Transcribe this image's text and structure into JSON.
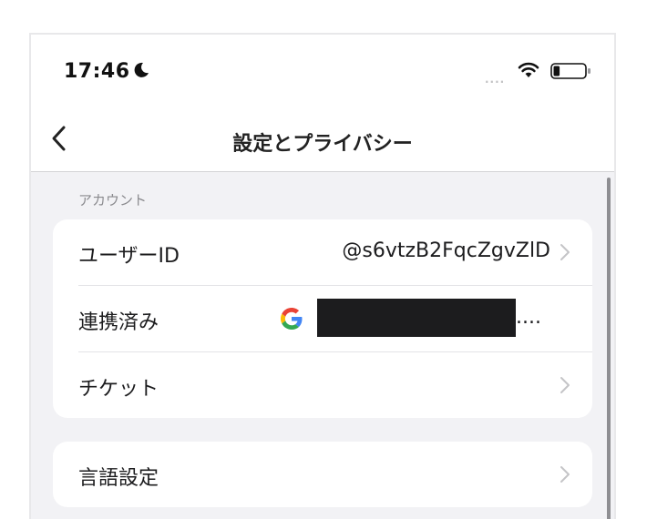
{
  "status_bar": {
    "time": "17:46",
    "moon_icon": "moon-icon",
    "signal_text": "....",
    "wifi_icon": "wifi-icon",
    "battery_icon": "battery-icon",
    "battery_level": 0.2
  },
  "navbar": {
    "back_icon": "chevron-left-icon",
    "title": "設定とプライバシー"
  },
  "account_section": {
    "header": "アカウント",
    "rows": [
      {
        "label": "ユーザーID",
        "value": "@s6vtzB2FqcZgvZlD",
        "chevron": true
      },
      {
        "label": "連携済み",
        "provider_icon": "google-icon",
        "value_redacted": true,
        "value_suffix": "...."
      },
      {
        "label": "チケット",
        "chevron": true
      }
    ]
  },
  "language_section": {
    "rows": [
      {
        "label": "言語設定",
        "chevron": true
      }
    ]
  },
  "colors": {
    "background_grouped": "#f2f2f5",
    "card": "#ffffff",
    "text_primary": "#1c1c1e",
    "text_secondary": "#8a8a8e",
    "chevron": "#c4c4c7"
  }
}
